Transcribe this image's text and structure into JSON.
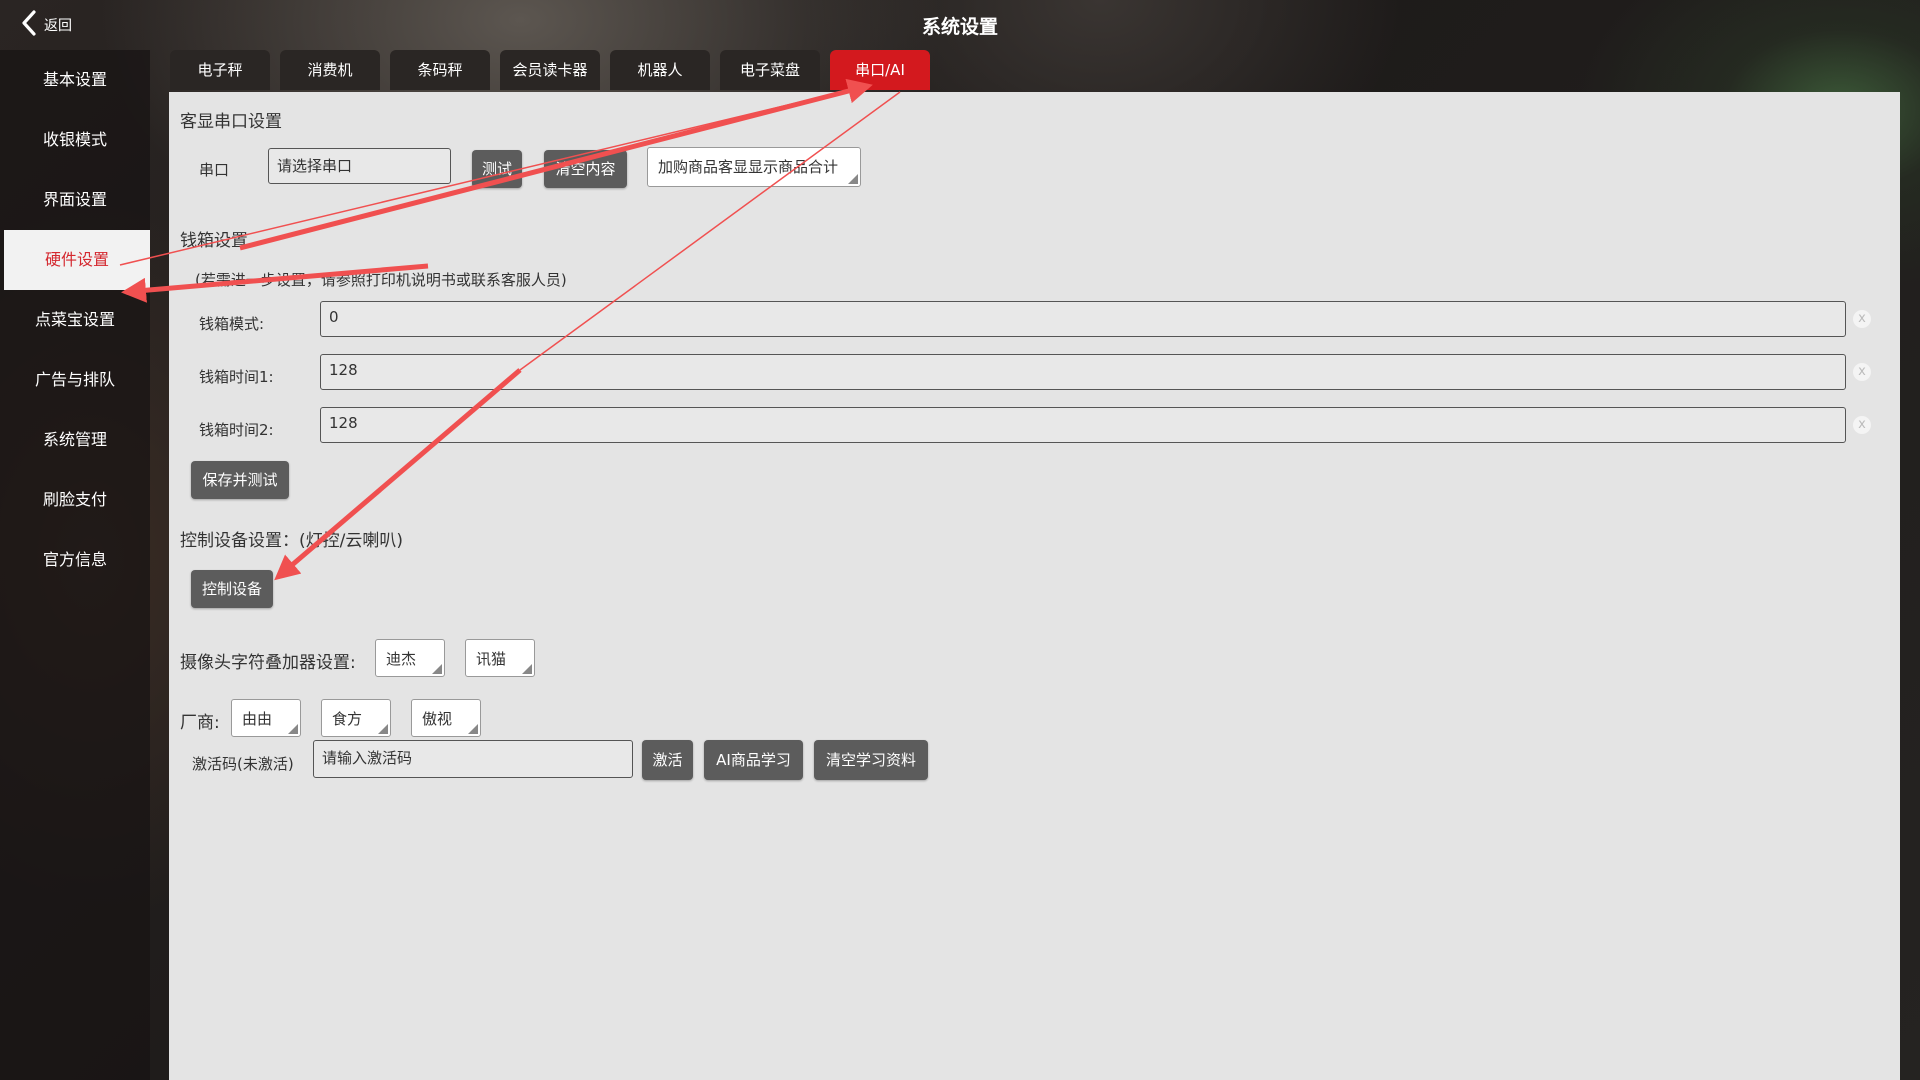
{
  "header": {
    "back_label": "返回",
    "title": "系统设置"
  },
  "sidebar": {
    "items": [
      {
        "label": "基本设置"
      },
      {
        "label": "收银模式"
      },
      {
        "label": "界面设置"
      },
      {
        "label": "硬件设置",
        "active": true
      },
      {
        "label": "点菜宝设置"
      },
      {
        "label": "广告与排队"
      },
      {
        "label": "系统管理"
      },
      {
        "label": "刷脸支付"
      },
      {
        "label": "官方信息"
      }
    ]
  },
  "tabs": [
    {
      "label": "电子秤"
    },
    {
      "label": "消费机"
    },
    {
      "label": "条码秤"
    },
    {
      "label": "会员读卡器"
    },
    {
      "label": "机器人"
    },
    {
      "label": "电子菜盘"
    },
    {
      "label": "串口/AI",
      "active": true
    }
  ],
  "serial": {
    "section_title": "客显串口设置",
    "port_label": "串口",
    "port_placeholder": "请选择串口",
    "test_button": "测试",
    "clear_button": "清空内容",
    "display_option": "加购商品客显显示商品合计"
  },
  "cashbox": {
    "section_title": "钱箱设置",
    "note": "(若需进一步设置，请参照打印机说明书或联系客服人员)",
    "fields": [
      {
        "label": "钱箱模式:",
        "value": "0",
        "clear": "x"
      },
      {
        "label": "钱箱时间1:",
        "value": "128",
        "clear": "x"
      },
      {
        "label": "钱箱时间2:",
        "value": "128",
        "clear": "x"
      }
    ],
    "save_button": "保存并测试"
  },
  "control": {
    "section_title": "控制设备设置：(灯控/云喇叭)",
    "button": "控制设备"
  },
  "camera": {
    "label": "摄像头字符叠加器设置:",
    "options": [
      "迪杰",
      "讯猫"
    ]
  },
  "vendor": {
    "label": "厂商:",
    "options": [
      "由由",
      "食方",
      "傲视"
    ]
  },
  "activation": {
    "label": "激活码(未激活)",
    "placeholder": "请输入激活码",
    "activate_button": "激活",
    "ai_learn_button": "AI商品学习",
    "clear_learn_button": "清空学习资料"
  },
  "colors": {
    "active_tab": "#d3191e",
    "active_nav_text": "#d4282f",
    "annotation_arrow": "#f05050"
  }
}
